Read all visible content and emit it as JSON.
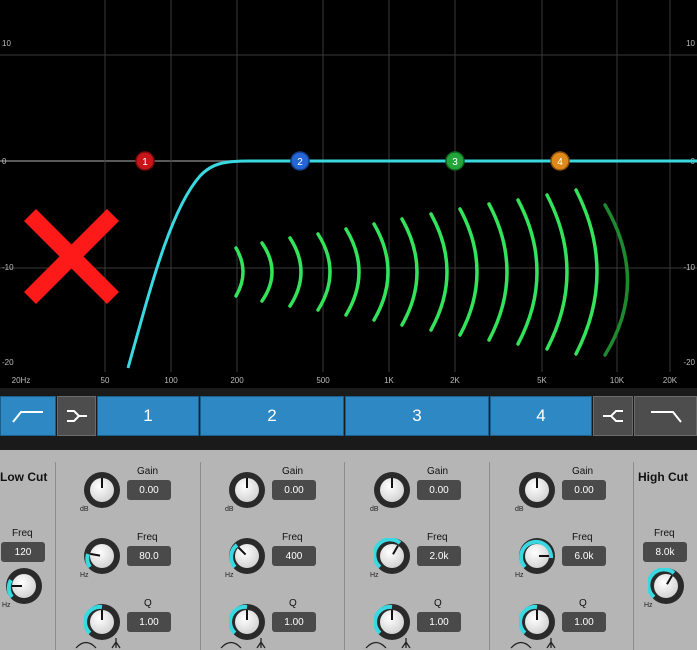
{
  "graph": {
    "y_labels_left": [
      "10",
      "0",
      "-10",
      "-20"
    ],
    "y_labels_right": [
      "10",
      "0",
      "-10",
      "-20"
    ],
    "x_labels": [
      "20Hz",
      "50",
      "100",
      "200",
      "500",
      "1K",
      "2K",
      "5K",
      "10K",
      "20K"
    ],
    "bands": [
      {
        "label": "1",
        "color": "#c8151a"
      },
      {
        "label": "2",
        "color": "#2466d6"
      },
      {
        "label": "3",
        "color": "#22a63a"
      },
      {
        "label": "4",
        "color": "#e0891b"
      }
    ],
    "curve_color": "#3ad8e0",
    "disabled_icon": "red-x-icon",
    "waves_icon": "sound-waves-icon"
  },
  "bandbar": {
    "low_cut_icon": "low-cut-filter-icon",
    "low_shelf_icon": "low-shelf-icon",
    "band1": "1",
    "band2": "2",
    "band3": "3",
    "band4": "4",
    "high_shelf_icon": "high-shelf-icon",
    "high_cut_icon": "high-cut-filter-icon"
  },
  "low_cut": {
    "title": "Low Cut",
    "freq_label": "Freq",
    "freq_value": "120",
    "unit": "Hz"
  },
  "high_cut": {
    "title": "High Cut",
    "freq_label": "Freq",
    "freq_value": "8.0k",
    "unit": "Hz"
  },
  "bands": [
    {
      "gain_label": "Gain",
      "gain_value": "0.00",
      "gain_unit": "dB",
      "freq_label": "Freq",
      "freq_value": "80.0",
      "freq_unit": "Hz",
      "q_label": "Q",
      "q_value": "1.00"
    },
    {
      "gain_label": "Gain",
      "gain_value": "0.00",
      "gain_unit": "dB",
      "freq_label": "Freq",
      "freq_value": "400",
      "freq_unit": "Hz",
      "q_label": "Q",
      "q_value": "1.00"
    },
    {
      "gain_label": "Gain",
      "gain_value": "0.00",
      "gain_unit": "dB",
      "freq_label": "Freq",
      "freq_value": "2.0k",
      "freq_unit": "Hz",
      "q_label": "Q",
      "q_value": "1.00"
    },
    {
      "gain_label": "Gain",
      "gain_value": "0.00",
      "gain_unit": "dB",
      "freq_label": "Freq",
      "freq_value": "6.0k",
      "freq_unit": "Hz",
      "q_label": "Q",
      "q_value": "1.00"
    }
  ],
  "colors": {
    "accent": "#2e88c3",
    "knob_arc": "#3ad8e0",
    "panel": "#b5b5b5"
  }
}
